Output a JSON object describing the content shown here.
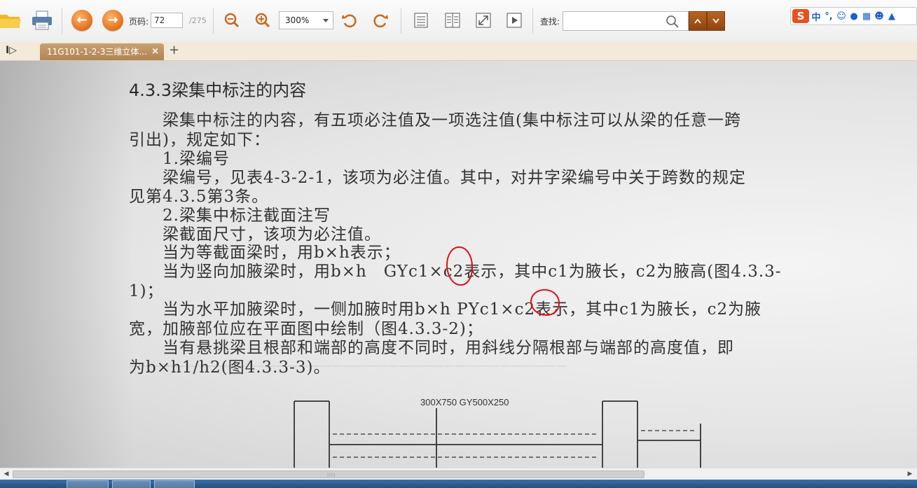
{
  "toolbar": {
    "page_label": "页码:",
    "page_value": "72",
    "page_total": "/275",
    "zoom_value": "300%",
    "search_label": "查找:",
    "search_value": "",
    "icons": [
      "folder-icon",
      "printer-icon",
      "prev-page-icon",
      "next-page-icon",
      "zoom-out-icon",
      "zoom-in-icon",
      "rotate-left-icon",
      "rotate-right-icon",
      "single-page-icon",
      "two-page-icon",
      "fullscreen-icon",
      "slideshow-icon",
      "search-icon",
      "chevron-up-icon",
      "chevron-down-icon"
    ]
  },
  "ime": {
    "logo": "S",
    "mode": "中",
    "punct": "°,"
  },
  "tabs": [
    {
      "label": "11G101-1-2-3三维立体...",
      "close": "×"
    }
  ],
  "new_tab": "+",
  "document": {
    "heading": "4.3.3梁集中标注的内容",
    "lines": [
      "　　梁集中标注的内容，有五项必注值及一项选注值(集中标注可以从梁的任意一跨",
      "引出)，规定如下：",
      "　　1.梁编号",
      "　　梁编号，见表4-3-2-1，该项为必注值。其中，对井字梁编号中关于跨数的规定",
      "见第4.3.5第3条。",
      "　　2.梁集中标注截面注写",
      "　　梁截面尺寸，该项为必注值。",
      "　　当为等截面梁时，用b×h表示；",
      "　　当为竖向加腋梁时，用b×h　GYc1×c2表示，其中c1为腋长，c2为腋高(图4.3.3-",
      "1)；",
      "　　当为水平加腋梁时，一侧加腋时用b×h PYc1×c2表示，其中c1为腋长，c2为腋",
      "宽，加腋部位应在平面图中绘制（图4.3.3-2)；",
      "　　当有悬挑梁且根部和端部的高度不同时，用斜线分隔根部与端部的高度值，即",
      "为b×h1/h2(图4.3.3-3)。"
    ],
    "figure_label": "300X750 GY500X250"
  },
  "colors": {
    "accent": "#e2701c",
    "tab": "#b08453",
    "annotation": "#e01010"
  }
}
